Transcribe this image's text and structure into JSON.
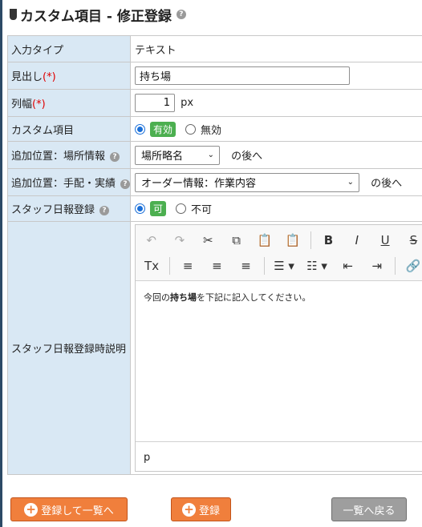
{
  "page": {
    "title": "カスタム項目 - 修正登録",
    "help_glyph": "?"
  },
  "form": {
    "input_type": {
      "label": "入力タイプ",
      "value": "テキスト"
    },
    "heading": {
      "label": "見出し",
      "required_mark": "(*)",
      "value": "持ち場"
    },
    "column_width": {
      "label": "列幅",
      "required_mark": "(*)",
      "value": "1",
      "unit": "px"
    },
    "custom_item": {
      "label": "カスタム項目",
      "options": [
        {
          "label": "有効",
          "selected": true
        },
        {
          "label": "無効",
          "selected": false
        }
      ]
    },
    "position_place": {
      "label": "追加位置：場所情報",
      "selected": "場所略名",
      "suffix": "の後へ"
    },
    "position_arrangement": {
      "label": "追加位置：手配・実績",
      "selected": "オーダー情報：作業内容",
      "suffix": "の後へ"
    },
    "staff_report": {
      "label": "スタッフ日報登録",
      "options": [
        {
          "label": "可",
          "selected": true
        },
        {
          "label": "不可",
          "selected": false
        }
      ]
    },
    "staff_report_desc": {
      "label": "スタッフ日報登録時説明",
      "content_prefix": "今回の",
      "content_bold": "持ち場",
      "content_suffix": "を下記に記入してください。",
      "path": "p"
    }
  },
  "toolbar": {
    "row1": [
      {
        "name": "undo-icon",
        "glyph": "↶",
        "disabled": true
      },
      {
        "name": "redo-icon",
        "glyph": "↷",
        "disabled": true
      },
      {
        "name": "cut-icon",
        "glyph": "✂"
      },
      {
        "name": "copy-icon",
        "glyph": "⧉"
      },
      {
        "name": "paste-icon",
        "glyph": "📋"
      },
      {
        "name": "paste-text-icon",
        "glyph": "📋"
      },
      {
        "name": "sep"
      },
      {
        "name": "bold-icon",
        "glyph": "B"
      },
      {
        "name": "italic-icon",
        "glyph": "I"
      },
      {
        "name": "underline-icon",
        "glyph": "U"
      },
      {
        "name": "strikethrough-icon",
        "glyph": "S"
      }
    ],
    "row2": [
      {
        "name": "remove-format-icon",
        "glyph": "Tx"
      },
      {
        "name": "sep"
      },
      {
        "name": "align-left-icon",
        "glyph": "≡"
      },
      {
        "name": "align-center-icon",
        "glyph": "≡"
      },
      {
        "name": "align-right-icon",
        "glyph": "≡"
      },
      {
        "name": "sep"
      },
      {
        "name": "bulleted-list-icon",
        "glyph": "☰ ▾"
      },
      {
        "name": "numbered-list-icon",
        "glyph": "☷ ▾"
      },
      {
        "name": "outdent-icon",
        "glyph": "⇤"
      },
      {
        "name": "indent-icon",
        "glyph": "⇥"
      },
      {
        "name": "sep"
      },
      {
        "name": "link-icon",
        "glyph": "🔗"
      }
    ]
  },
  "buttons": {
    "save_and_list": "登録して一覧へ",
    "save": "登録",
    "back_to_list": "一覧へ戻る",
    "plus_glyph": "+"
  },
  "colors": {
    "label_bg": "#d9e8f4",
    "accent_orange": "#f07f3c",
    "gray_button": "#9e9e9e",
    "active_green": "#4caf50",
    "required_red": "#e00000"
  }
}
